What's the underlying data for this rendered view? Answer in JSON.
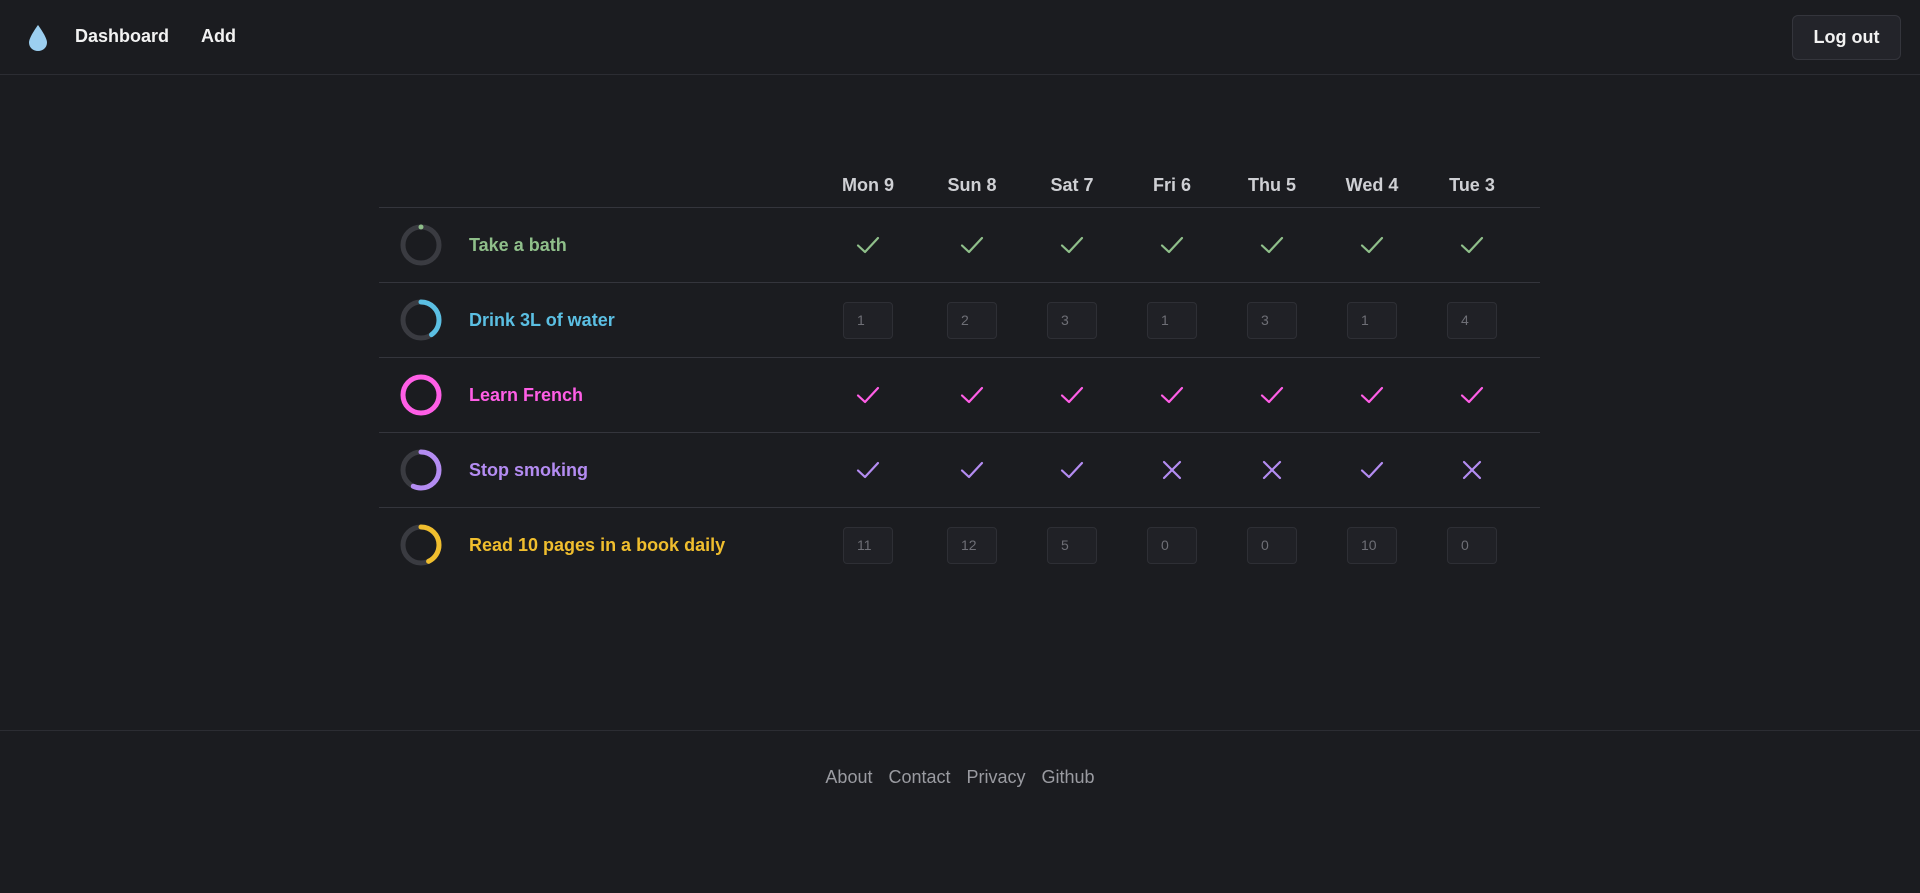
{
  "nav": {
    "logo_icon": "droplet-icon",
    "logo_color": "#9ccff0",
    "dashboard_label": "Dashboard",
    "add_label": "Add",
    "logout_label": "Log out"
  },
  "days": [
    "Mon 9",
    "Sun 8",
    "Sat 7",
    "Fri 6",
    "Thu 5",
    "Wed 4",
    "Tue 3"
  ],
  "habits": [
    {
      "name": "Take a bath",
      "color": "#8fbf8a",
      "type": "check",
      "progress": 0.0,
      "entries": [
        "done",
        "done",
        "done",
        "done",
        "done",
        "done",
        "done"
      ]
    },
    {
      "name": "Drink 3L of water",
      "color": "#5bbfe3",
      "type": "number",
      "progress": 0.4,
      "entries": [
        "1",
        "2",
        "3",
        "1",
        "3",
        "1",
        "4"
      ]
    },
    {
      "name": "Learn French",
      "color": "#ff5ee6",
      "type": "check",
      "progress": 1.0,
      "entries": [
        "done",
        "done",
        "done",
        "done",
        "done",
        "done",
        "done"
      ]
    },
    {
      "name": "Stop smoking",
      "color": "#b48cf2",
      "type": "check",
      "progress": 0.57,
      "entries": [
        "done",
        "done",
        "done",
        "missed",
        "missed",
        "done",
        "missed"
      ]
    },
    {
      "name": "Read 10 pages in a book daily",
      "color": "#f0be2e",
      "type": "number",
      "progress": 0.43,
      "entries": [
        "11",
        "12",
        "5",
        "0",
        "0",
        "10",
        "0"
      ]
    }
  ],
  "footer": {
    "links": [
      "About",
      "Contact",
      "Privacy",
      "Github"
    ]
  }
}
